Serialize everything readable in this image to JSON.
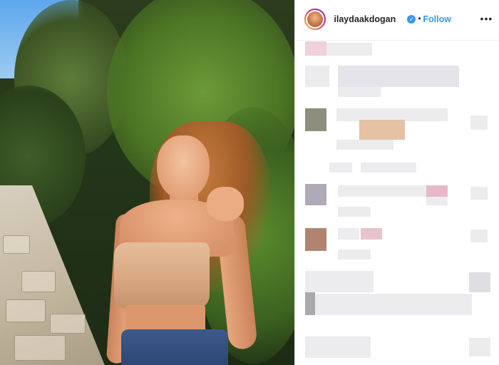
{
  "post": {
    "username": "ilaydaakdogan",
    "verified_icon": "verified-badge-icon",
    "separator": "•",
    "follow_label": "Follow",
    "more_icon": "more-options-icon",
    "more_glyph": "•••"
  },
  "colors": {
    "accent": "#3897f0",
    "text": "#262626",
    "divider": "#efefef",
    "pixelated_placeholder": "#e6e6ea"
  },
  "comments_pixelated": true
}
